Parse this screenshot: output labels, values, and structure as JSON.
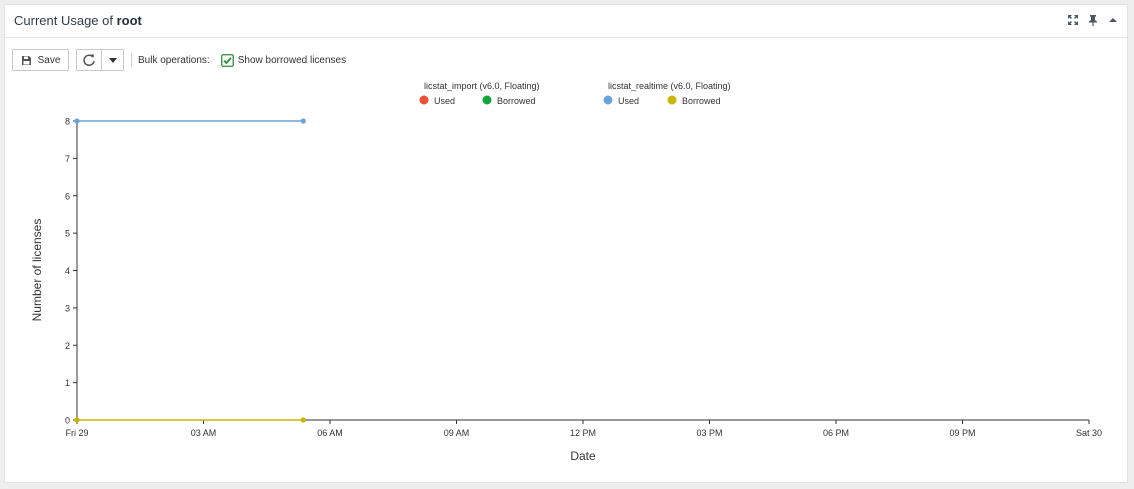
{
  "header": {
    "title_prefix": "Current Usage of ",
    "title_user": "root",
    "icons": [
      "fullscreen-icon",
      "pin-icon",
      "collapse-icon"
    ]
  },
  "toolbar": {
    "save_label": "Save",
    "bulk_label": "Bulk operations:",
    "show_borrowed_label": "Show borrowed licenses",
    "show_borrowed_checked": true
  },
  "chart_data": {
    "type": "line",
    "xlabel": "Date",
    "ylabel": "Number of licenses",
    "ylim": [
      0,
      8
    ],
    "yticks": [
      "0",
      "1",
      "2",
      "3",
      "4",
      "5",
      "6",
      "7",
      "8"
    ],
    "xlim": [
      "2023-09-29T00:00",
      "2023-09-30T00:00"
    ],
    "xticks": [
      {
        "t": "2023-09-29T00:00",
        "label": "Fri 29"
      },
      {
        "t": "2023-09-29T03:00",
        "label": "03 AM"
      },
      {
        "t": "2023-09-29T06:00",
        "label": "06 AM"
      },
      {
        "t": "2023-09-29T09:00",
        "label": "09 AM"
      },
      {
        "t": "2023-09-29T12:00",
        "label": "12 PM"
      },
      {
        "t": "2023-09-29T15:00",
        "label": "03 PM"
      },
      {
        "t": "2023-09-29T18:00",
        "label": "06 PM"
      },
      {
        "t": "2023-09-29T21:00",
        "label": "09 PM"
      },
      {
        "t": "2023-09-30T00:00",
        "label": "Sat 30"
      }
    ],
    "legend_groups": [
      {
        "name": "licstat_import (v6.0, Floating)",
        "items": [
          {
            "label": "Used",
            "color": "#f04e37"
          },
          {
            "label": "Borrowed",
            "color": "#13a538"
          }
        ]
      },
      {
        "name": "licstat_realtime (v6.0, Floating)",
        "items": [
          {
            "label": "Used",
            "color": "#6aa3dc"
          },
          {
            "label": "Borrowed",
            "color": "#c9b400"
          }
        ]
      }
    ],
    "series": [
      {
        "color": "#6aa3dc",
        "points": [
          {
            "x": "2023-09-29T00:00",
            "y": 8
          },
          {
            "x": "2023-09-29T05:22",
            "y": 8
          }
        ]
      },
      {
        "color": "#c9b400",
        "points": [
          {
            "x": "2023-09-29T00:00",
            "y": 0
          },
          {
            "x": "2023-09-29T05:22",
            "y": 0
          }
        ]
      }
    ]
  }
}
